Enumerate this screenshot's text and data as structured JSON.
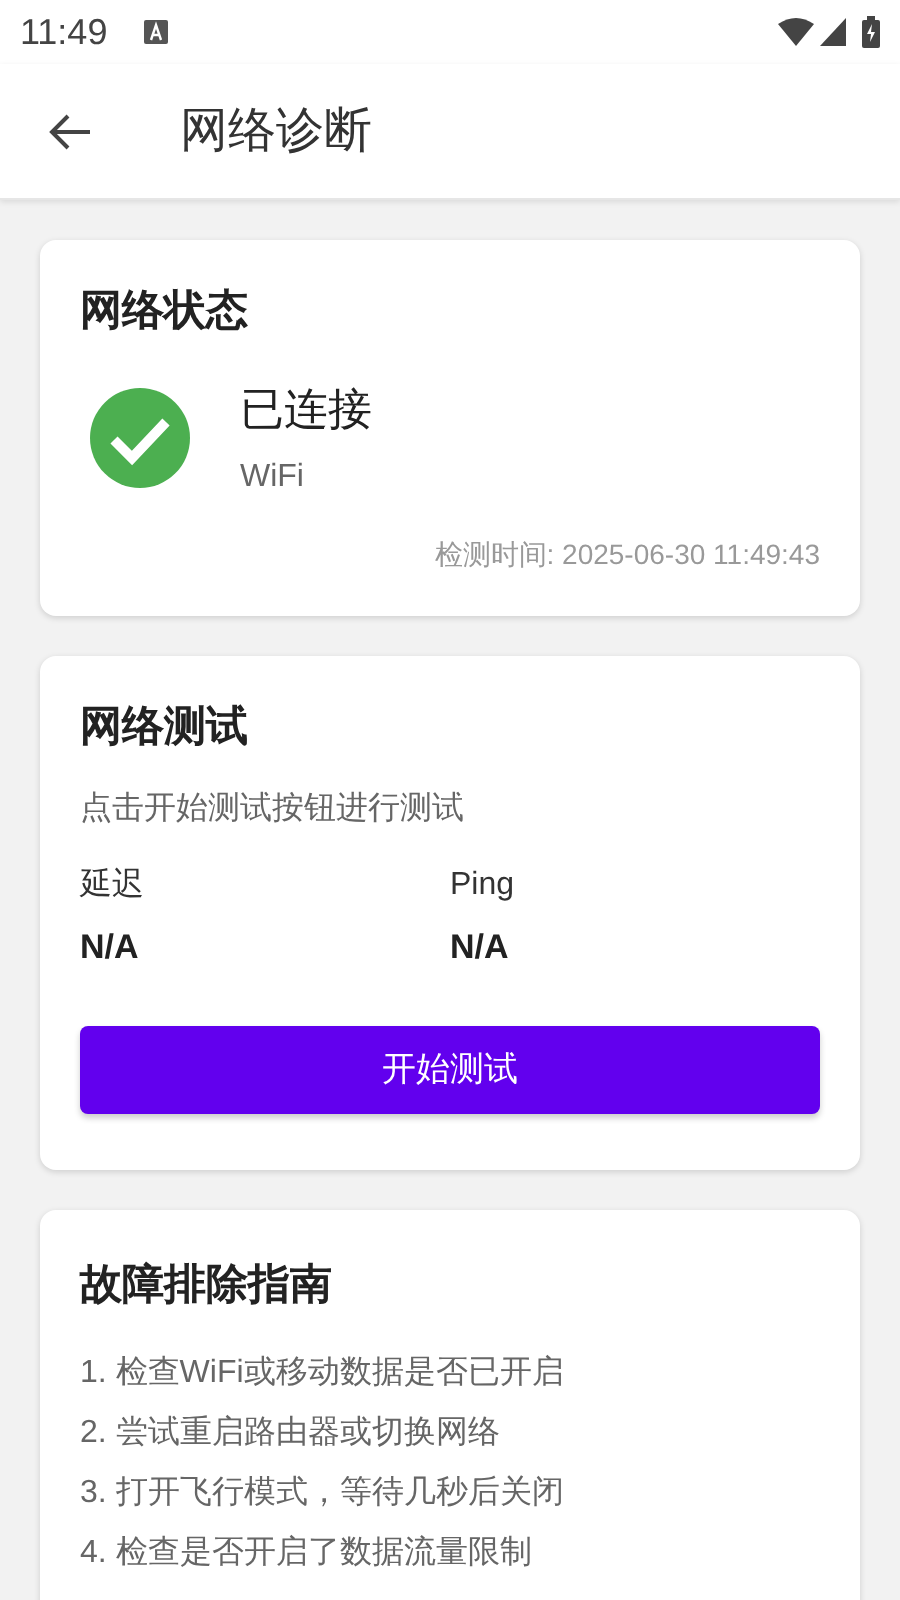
{
  "status_bar": {
    "time": "11:49"
  },
  "app_bar": {
    "title": "网络诊断"
  },
  "status_card": {
    "title": "网络状态",
    "connected": true,
    "state": "已连接",
    "network_type": "WiFi",
    "checked_at": "检测时间: 2025-06-30 11:49:43"
  },
  "test_card": {
    "title": "网络测试",
    "hint": "点击开始测试按钮进行测试",
    "metrics": [
      {
        "label": "延迟",
        "value": "N/A"
      },
      {
        "label": "Ping",
        "value": "N/A"
      }
    ],
    "button": "开始测试"
  },
  "guide_card": {
    "title": "故障排除指南",
    "steps": [
      "1. 检查WiFi或移动数据是否已开启",
      "2. 尝试重启路由器或切换网络",
      "3. 打开飞行模式，等待几秒后关闭",
      "4. 检查是否开启了数据流量限制"
    ]
  }
}
